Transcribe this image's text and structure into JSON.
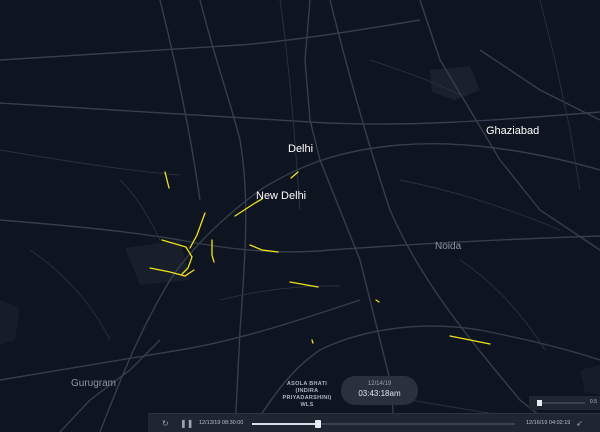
{
  "map": {
    "labels": {
      "delhi": "Delhi",
      "new_delhi": "New Delhi",
      "ghaziabad": "Ghaziabad",
      "noida": "Noida",
      "gurugram": "Gurugram"
    },
    "place_popup": [
      "ASOLA BHATI",
      "(INDIRA",
      "PRIYADARSHINI)",
      "WLS"
    ],
    "colors": {
      "background": "#0e1420",
      "roads": "#3a4352",
      "trips": "#f2e21a"
    }
  },
  "clock": {
    "date": "12/14/19",
    "time": "03:43:18am"
  },
  "playback": {
    "start_time": "12/13/19 08:30:00",
    "end_time": "12/16/19 04:02:19",
    "progress": 0.25,
    "icons": [
      "rewind-icon",
      "pause-icon",
      "rocket-icon"
    ]
  },
  "speed": {
    "value": "0.5"
  }
}
